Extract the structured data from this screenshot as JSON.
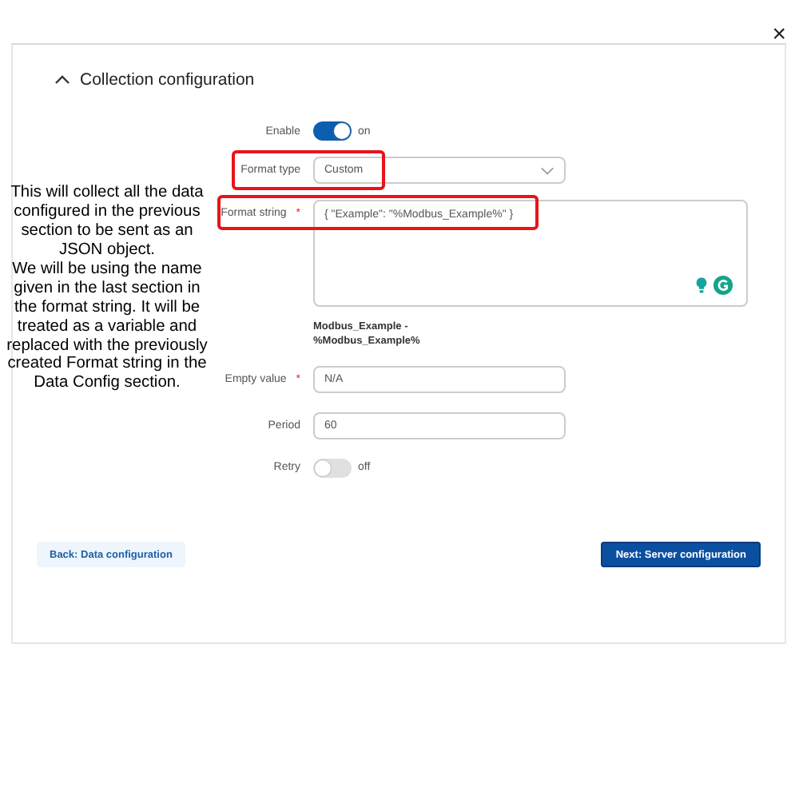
{
  "close": "×",
  "section": {
    "title": "Collection configuration",
    "expanded": true
  },
  "fields": [
    {
      "kind": "toggle",
      "label": "Enable",
      "on": true,
      "state_text": "on",
      "highlighted": false
    },
    {
      "kind": "select",
      "label": "Format type",
      "value": "Custom",
      "highlighted": true
    },
    {
      "kind": "textarea",
      "label": "Format string",
      "required_mark": "*",
      "value": "{ \"Example\": \"%Modbus_Example%\" }",
      "hint": "Modbus_Example -\n%Modbus_Example%",
      "highlighted": true
    },
    {
      "kind": "text",
      "label": "Empty value",
      "required_mark": "*",
      "value": "N/A",
      "highlighted": false
    },
    {
      "kind": "text",
      "label": "Period",
      "value": "60",
      "highlighted": false
    },
    {
      "kind": "toggle",
      "label": "Retry",
      "on": false,
      "state_text": "off",
      "highlighted": false
    }
  ],
  "annotation": "This will collect all the data configured in the previous section to be sent as an JSON object.\nWe will be using the name given in the last section in the format string. It will be treated as a variable and replaced with the previously created Format string in the Data Config section.",
  "buttons": {
    "back": "Back: Data configuration",
    "next": "Next: Server configuration"
  }
}
